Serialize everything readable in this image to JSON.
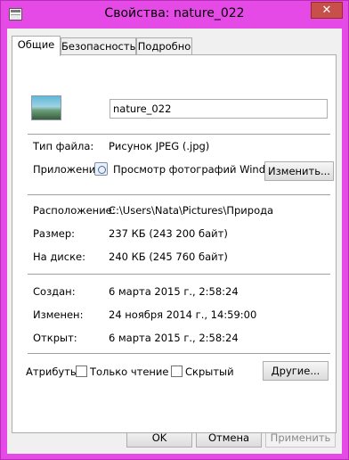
{
  "window": {
    "title": "Свойства: nature_022",
    "close_glyph": "✕"
  },
  "tabs": [
    {
      "label": "Общие",
      "active": true
    },
    {
      "label": "Безопасность",
      "active": false
    },
    {
      "label": "Подробно",
      "active": false
    }
  ],
  "file": {
    "icon": "image-file-icon",
    "name": "nature_022"
  },
  "type_section": {
    "file_type_label": "Тип файла:",
    "file_type_value": "Рисунок JPEG (.jpg)",
    "app_label": "Приложение:",
    "app_icon": "photo-viewer-icon",
    "app_value": "Просмотр фотографий Windows",
    "change_button": "Изменить..."
  },
  "location_section": {
    "location_label": "Расположение:",
    "location_value": "C:\\Users\\Nata\\Pictures\\Природа",
    "size_label": "Размер:",
    "size_value": "237 КБ (243 200 байт)",
    "disk_label": "На диске:",
    "disk_value": "240 КБ (245 760 байт)"
  },
  "dates_section": {
    "created_label": "Создан:",
    "created_value": "6 марта 2015 г., 2:58:24",
    "modified_label": "Изменен:",
    "modified_value": "24 ноября 2014 г., 14:59:00",
    "opened_label": "Открыт:",
    "opened_value": "6 марта 2015 г., 2:58:24"
  },
  "attributes": {
    "label": "Атрибуты:",
    "readonly_label": "Только чтение",
    "readonly_checked": false,
    "hidden_label": "Скрытый",
    "hidden_checked": false,
    "other_button": "Другие..."
  },
  "footer": {
    "ok": "OK",
    "cancel": "Отмена",
    "apply": "Применить"
  },
  "colors": {
    "frame": "#e64ae6",
    "highlight": "#e4141c",
    "close": "#c7504a"
  }
}
